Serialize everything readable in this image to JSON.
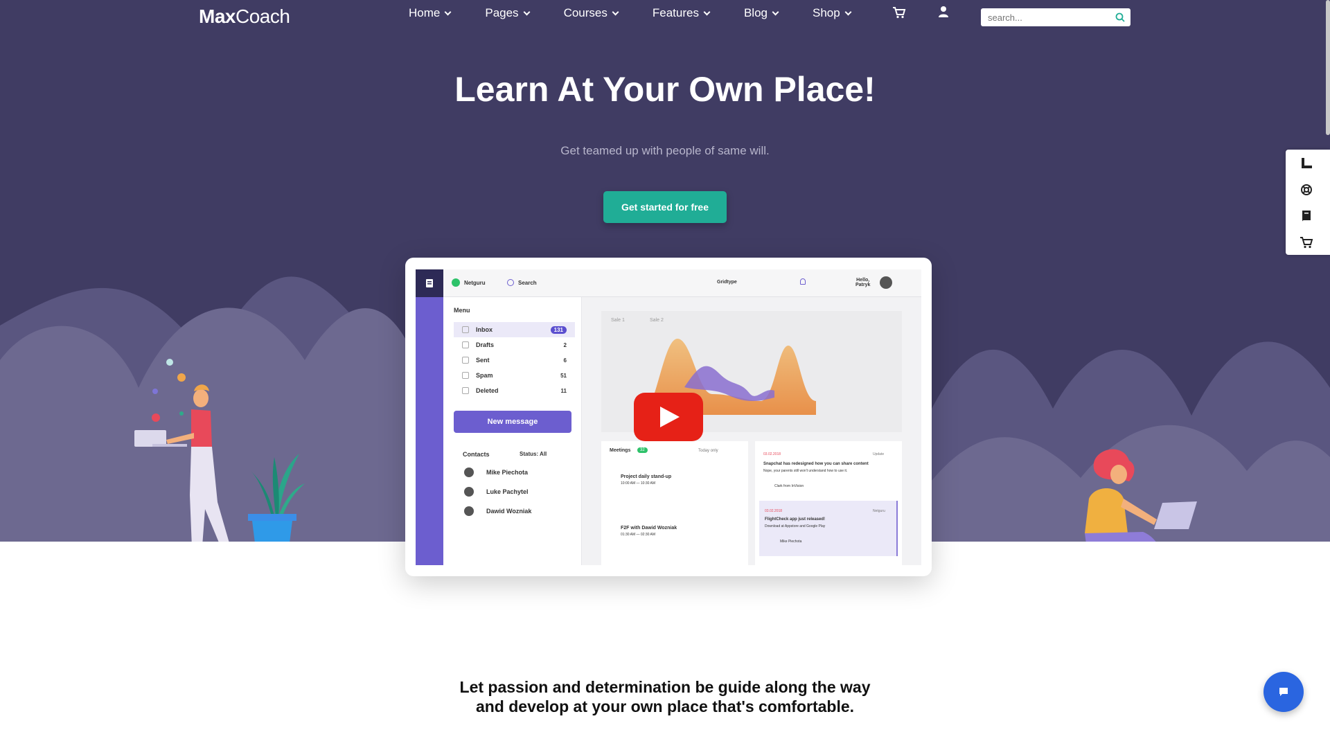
{
  "header": {
    "logo_bold": "Max",
    "logo_rest": "Coach",
    "nav": [
      {
        "label": "Home"
      },
      {
        "label": "Pages"
      },
      {
        "label": "Courses"
      },
      {
        "label": "Features"
      },
      {
        "label": "Blog"
      },
      {
        "label": "Shop"
      }
    ],
    "search_placeholder": "search..."
  },
  "hero": {
    "title": "Learn At Your Own Place!",
    "subtitle": "Get teamed up with people of same will.",
    "cta_label": "Get started for free"
  },
  "video_preview": {
    "topbar": {
      "workspace": "Netguru",
      "search": "Search",
      "gridtype": "Gridtype",
      "greeting_line1": "Hello,",
      "greeting_line2": "Patryk"
    },
    "menu_title": "Menu",
    "menu_items": [
      {
        "label": "Inbox",
        "count": "131"
      },
      {
        "label": "Drafts",
        "count": "2"
      },
      {
        "label": "Sent",
        "count": "6"
      },
      {
        "label": "Spam",
        "count": "51"
      },
      {
        "label": "Deleted",
        "count": "11"
      }
    ],
    "new_message": "New message",
    "contacts_title": "Contacts",
    "contacts_status": "Status: All",
    "contacts": [
      {
        "name": "Mike Piechota"
      },
      {
        "name": "Luke Pachytel"
      },
      {
        "name": "Dawid Wozniak"
      }
    ],
    "legend": [
      "Sale 1",
      "Sale 2"
    ],
    "meetings_title": "Meetings",
    "meetings_badge": "32",
    "today_only": "Today only",
    "meetings": [
      {
        "title": "Project daily stand-up",
        "time": "10:00 AM — 10:30 AM"
      },
      {
        "title": "F2F with Dawid Wozniak",
        "time": "01:30 AM — 02:30 AM"
      }
    ],
    "news": [
      {
        "date": "03.02.2018",
        "tag": "Update",
        "title": "Snapchat has redesigned how you can share content",
        "body": "Nope, your parents still won't understand how to use it.",
        "author": "Clark from InVision"
      },
      {
        "date": "03.02.2018",
        "tag": "Netguru",
        "title": "FlightCheck app just released!",
        "body": "Download at Appstore and Google Play",
        "author": "Mike Piechota"
      }
    ]
  },
  "bottom": {
    "text": "Let passion and determination be guide along the way and develop at your own place that's comfortable."
  },
  "colors": {
    "hero_bg": "#403c63",
    "accent_teal": "#20ad96",
    "chat_blue": "#2a65e0",
    "app_purple": "#6c5ecf"
  }
}
